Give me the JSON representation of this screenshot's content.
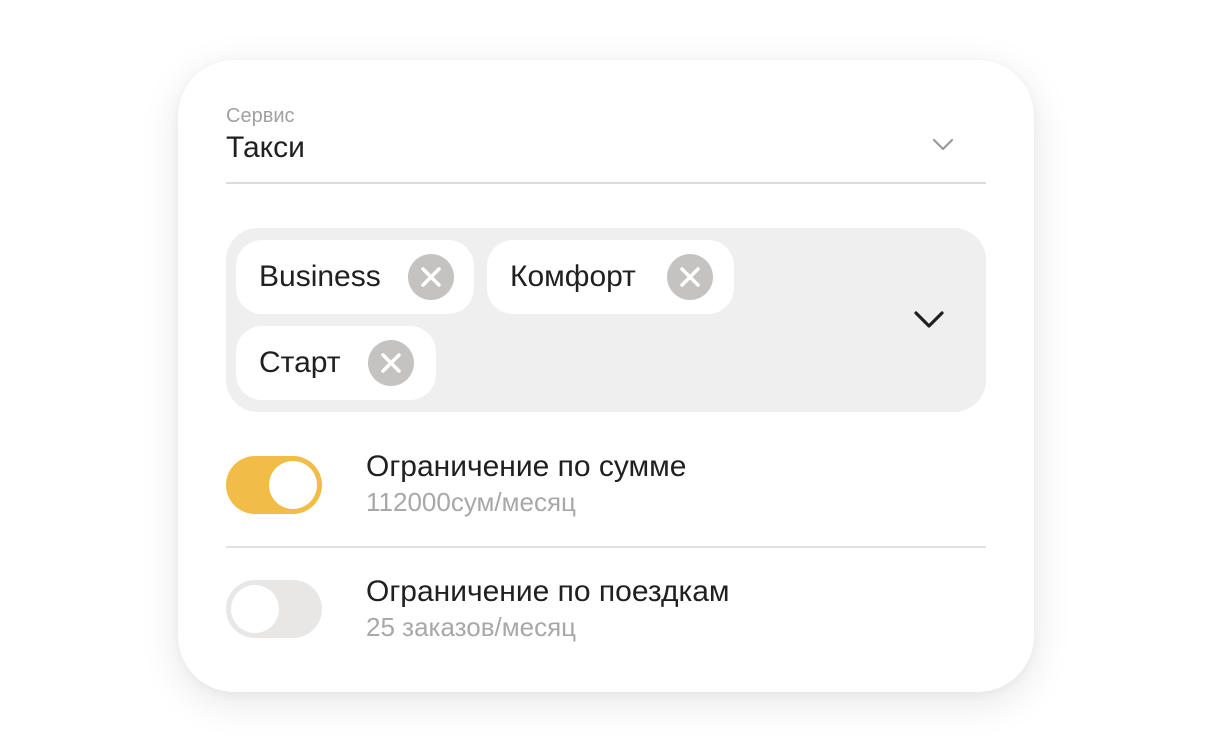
{
  "service": {
    "label": "Сервис",
    "value": "Такси",
    "chevron_icon": "chevron-down-icon"
  },
  "tariffs": {
    "chips": [
      {
        "label": "Business",
        "remove_icon": "close-circle-icon"
      },
      {
        "label": "Комфорт",
        "remove_icon": "close-circle-icon"
      },
      {
        "label": "Старт",
        "remove_icon": "close-circle-icon"
      }
    ],
    "chevron_icon": "chevron-down-icon"
  },
  "limits": [
    {
      "title": "Ограничение по сумме",
      "subtitle": "112000сум/месяц",
      "enabled": true
    },
    {
      "title": "Ограничение по поездкам",
      "subtitle": "25 заказов/месяц",
      "enabled": false
    }
  ],
  "colors": {
    "accent": "#f1bd47",
    "chip_remove": "#c4c3c1",
    "tags_background": "#efefef",
    "toggle_off": "#e8e7e5"
  }
}
